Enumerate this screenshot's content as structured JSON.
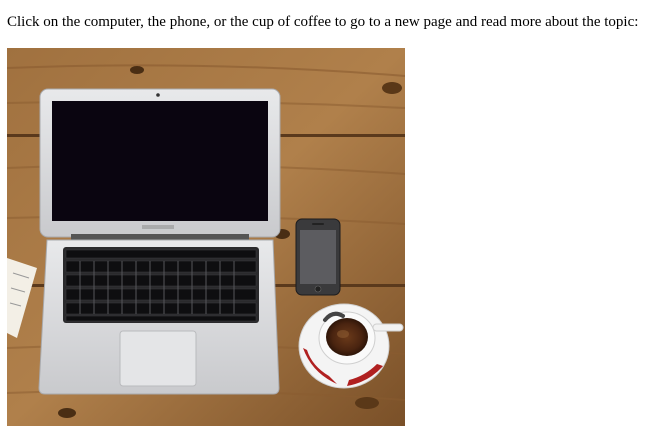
{
  "intro_text": "Click on the computer, the phone, or the cup of coffee to go to a new page and read more about the topic:",
  "image_map": {
    "areas": [
      {
        "name": "computer",
        "icon": "laptop-icon"
      },
      {
        "name": "phone",
        "icon": "smartphone-icon"
      },
      {
        "name": "coffee",
        "icon": "coffee-cup-icon"
      }
    ]
  },
  "colors": {
    "wood": "#9a6a3c",
    "wood_dark": "#6b4422",
    "laptop_silver": "#d9dadc",
    "screen": "#0a0510",
    "phone_body": "#3a3a3c",
    "saucer_accent": "#b02020"
  }
}
